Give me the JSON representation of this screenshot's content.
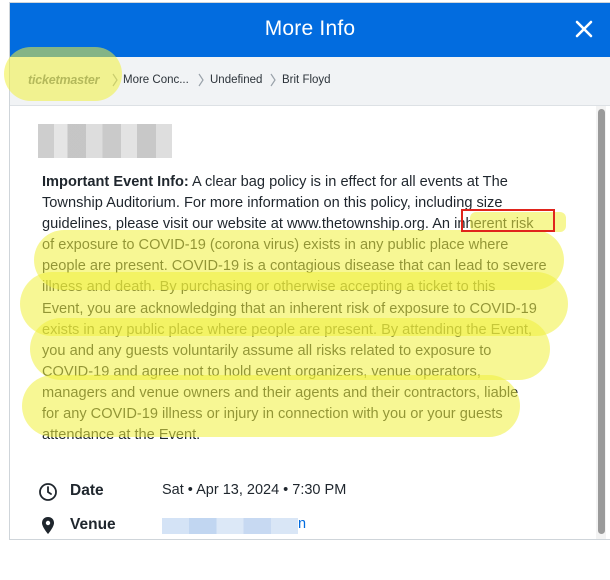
{
  "modal": {
    "title": "More Info",
    "close_icon": "close-icon"
  },
  "breadcrumb": {
    "logo_text": "ticketmaster",
    "items": [
      "More Conc...",
      "Undefined",
      "Brit Floyd"
    ]
  },
  "event_info": {
    "label": "Important Event Info:",
    "lines": [
      " A clear bag policy is in effect for all events at The",
      "Township Auditorium. For more information on this policy, including size",
      "guidelines, please visit our website at www.thetownship.org. An inherent risk",
      "of exposure to COVID-19 (corona virus) exists in any public place where",
      "people are present. COVID-19 is a contagious disease that can lead to severe",
      "illness and death. By purchasing or otherwise accepting a ticket to this",
      "Event, you are acknowledging that an inherent risk of exposure to COVID-19",
      "exists in any public place where people are present. By attending the Event,",
      "you and any guests voluntarily assume all risks related to exposure to",
      "COVID-19 and agree not to hold event organizers, venue operators,",
      "managers and venue owners and their agents and their contractors, liable",
      "for any COVID-19 illness or injury in connection with you or your guests",
      "attendance at the Event."
    ]
  },
  "details": {
    "date_label": "Date",
    "date_value": "Sat • Apr 13, 2024 • 7:30 PM",
    "venue_label": "Venue",
    "venue_value_visible": "n"
  },
  "colors": {
    "brand_blue": "#026cdf",
    "highlight": "#f0f03c",
    "annotation_red": "#e0241c"
  }
}
